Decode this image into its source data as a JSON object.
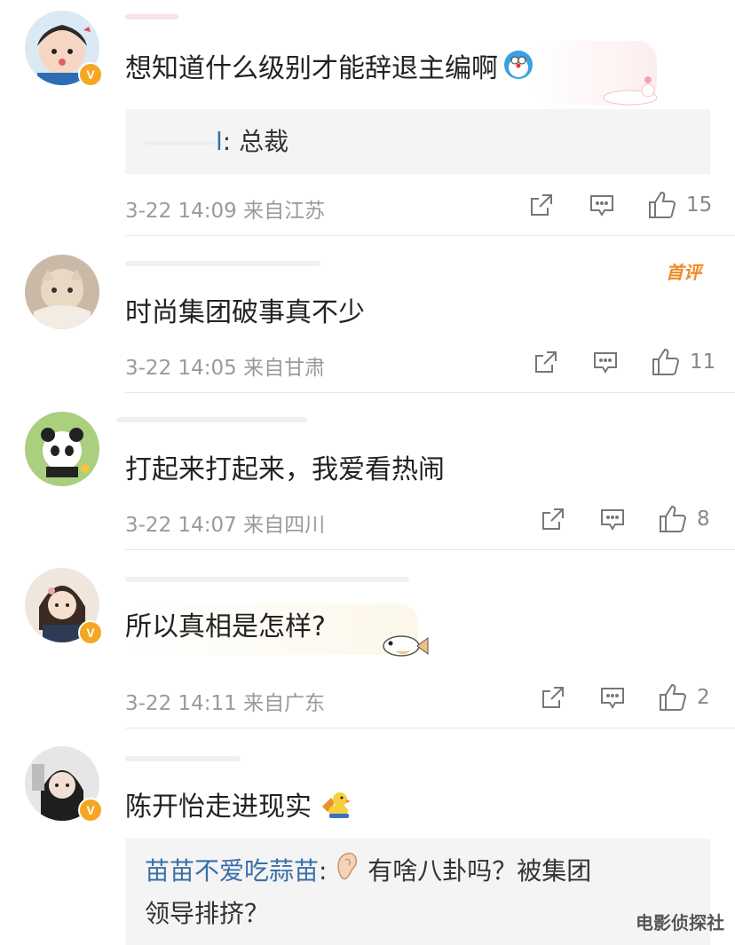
{
  "comments": [
    {
      "content": "想知道什么级别才能辞退主编啊",
      "reply": {
        "name_suffix": "l",
        "text": ": 总裁"
      },
      "meta": "3-22 14:09  来自江苏",
      "likes": "15"
    },
    {
      "badge": "首评",
      "content": "时尚集团破事真不少",
      "meta": "3-22 14:05  来自甘肃",
      "likes": "11"
    },
    {
      "content": "打起来打起来，我爱看热闹",
      "meta": "3-22 14:07  来自四川",
      "likes": "8"
    },
    {
      "content": "所以真相是怎样?",
      "meta": "3-22 14:11  来自广东",
      "likes": "2"
    },
    {
      "content": "陈开怡走进现实",
      "reply": {
        "name": "苗苗不爱吃蒜苗",
        "sep": ":",
        "text_line1": "有啥八卦吗？被集团",
        "text_line2": "领导排挤？"
      }
    }
  ],
  "watermark": "电影侦探社",
  "colors": {
    "reply_name": "#3a6ea8",
    "verified_badge": "#f5a623",
    "first_badge": "#f08a24"
  }
}
